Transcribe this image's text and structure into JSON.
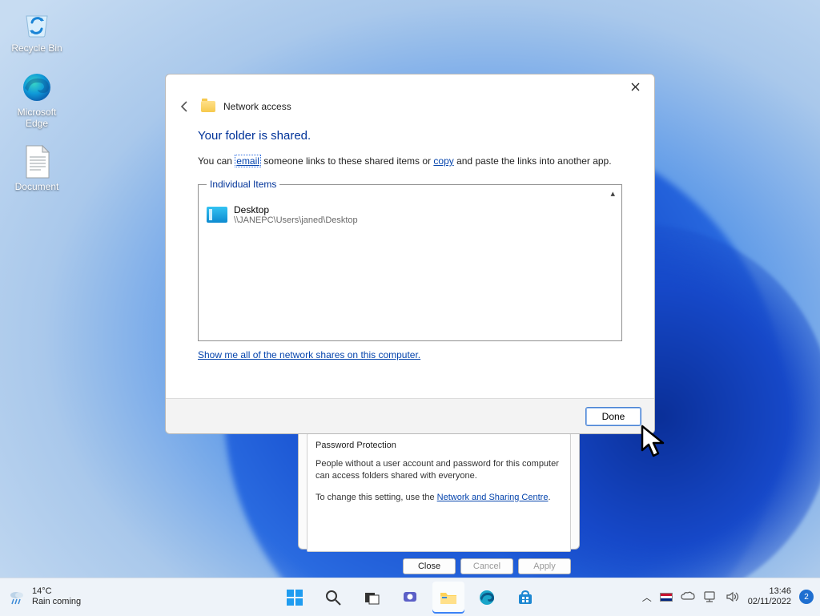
{
  "desktop": {
    "icons": [
      {
        "label": "Recycle Bin"
      },
      {
        "label": "Microsoft Edge"
      },
      {
        "label": "Document"
      }
    ]
  },
  "dialog": {
    "title": "Network access",
    "heading": "Your folder is shared.",
    "subtext_pre": "You can ",
    "email_link": "email",
    "subtext_mid": " someone links to these shared items or ",
    "copy_link": "copy",
    "subtext_post": " and paste the links into another app.",
    "group_legend": "Individual Items",
    "item_name": "Desktop",
    "item_path": "\\\\JANEPC\\Users\\janed\\Desktop",
    "show_all_link": "Show me all of the network shares on this computer.",
    "done_button": "Done"
  },
  "properties": {
    "group_title": "Password Protection",
    "line1": "People without a user account and password for this computer can access folders shared with everyone.",
    "line2_pre": "To change this setting, use the ",
    "net_link": "Network and Sharing Centre",
    "line2_post": ".",
    "close": "Close",
    "cancel": "Cancel",
    "apply": "Apply"
  },
  "taskbar": {
    "weather_temp": "14°C",
    "weather_desc": "Rain coming",
    "time": "13:46",
    "date": "02/11/2022",
    "notif_count": "2"
  }
}
